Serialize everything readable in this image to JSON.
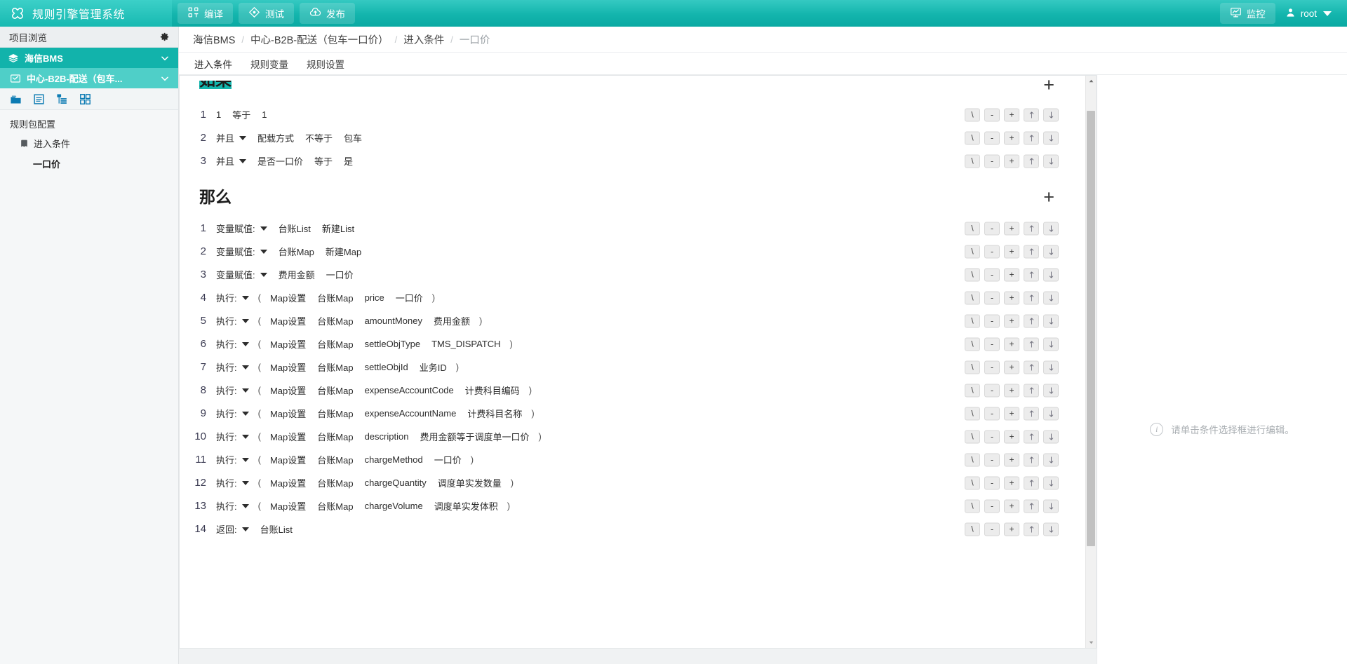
{
  "header": {
    "brand_title": "规则引擎管理系统",
    "logo_icon": "infinity-knot-logo",
    "nav": [
      {
        "label": "编译",
        "icon": "compile-icon"
      },
      {
        "label": "测试",
        "icon": "diamond-test-icon"
      },
      {
        "label": "发布",
        "icon": "cloud-upload-icon"
      }
    ],
    "monitor": {
      "label": "监控",
      "icon": "monitor-chart-icon"
    },
    "user": {
      "name": "root",
      "icon": "user-avatar-icon",
      "caret": "chevron-down-icon"
    }
  },
  "sidebar": {
    "title": "项目浏览",
    "gear_icon": "gear-icon",
    "tree": [
      {
        "label": "海信BMS",
        "icon": "layers-icon",
        "chevron": "chevron-down-icon",
        "level": 1
      },
      {
        "label": "中心-B2B-配送（包车...",
        "icon": "envelope-check-icon",
        "chevron": "chevron-down-icon",
        "level": 2
      }
    ],
    "toolbar_icons": [
      "folder-icon",
      "document-list-icon",
      "tree-outline-icon",
      "grid-icon"
    ],
    "section_label": "规则包配置",
    "items": [
      {
        "label": "进入条件",
        "icon": "book-icon"
      }
    ],
    "leaf": {
      "label": "一口价"
    }
  },
  "breadcrumb": {
    "items": [
      "海信BMS",
      "中心-B2B-配送（包车一口价）",
      "进入条件",
      "一口价"
    ],
    "separator": "/"
  },
  "tabs": [
    {
      "label": "进入条件",
      "active": true
    },
    {
      "label": "规则变量",
      "active": false
    },
    {
      "label": "规则设置",
      "active": false
    }
  ],
  "editor": {
    "if_section": {
      "title": "如果",
      "add_label": "+",
      "rows": [
        {
          "num": "1",
          "fields": [
            {
              "text": "1",
              "type": "value"
            },
            {
              "text": "等于",
              "type": "op"
            },
            {
              "text": "1",
              "type": "value"
            }
          ]
        },
        {
          "num": "2",
          "fields": [
            {
              "text": "并且",
              "type": "dropdown"
            },
            {
              "text": "配载方式",
              "type": "value"
            },
            {
              "text": "不等于",
              "type": "op"
            },
            {
              "text": "包车",
              "type": "value"
            }
          ]
        },
        {
          "num": "3",
          "fields": [
            {
              "text": "并且",
              "type": "dropdown"
            },
            {
              "text": "是否一口价",
              "type": "value"
            },
            {
              "text": "等于",
              "type": "op"
            },
            {
              "text": "是",
              "type": "value"
            }
          ]
        }
      ]
    },
    "then_section": {
      "title": "那么",
      "add_label": "+",
      "rows": [
        {
          "num": "1",
          "fields": [
            {
              "text": "变量赋值:",
              "type": "dropdown"
            },
            {
              "text": "台账List",
              "type": "value"
            },
            {
              "text": "新建List",
              "type": "value"
            }
          ]
        },
        {
          "num": "2",
          "fields": [
            {
              "text": "变量赋值:",
              "type": "dropdown"
            },
            {
              "text": "台账Map",
              "type": "value"
            },
            {
              "text": "新建Map",
              "type": "value"
            }
          ]
        },
        {
          "num": "3",
          "fields": [
            {
              "text": "变量赋值:",
              "type": "dropdown"
            },
            {
              "text": "费用金额",
              "type": "value"
            },
            {
              "text": "一口价",
              "type": "value"
            }
          ]
        },
        {
          "num": "4",
          "fields": [
            {
              "text": "执行:",
              "type": "dropdown"
            },
            {
              "text": "(",
              "type": "paren"
            },
            {
              "text": "Map设置",
              "type": "value"
            },
            {
              "text": "台账Map",
              "type": "value"
            },
            {
              "text": "price",
              "type": "value"
            },
            {
              "text": "一口价",
              "type": "value"
            },
            {
              "text": ")",
              "type": "paren"
            }
          ]
        },
        {
          "num": "5",
          "fields": [
            {
              "text": "执行:",
              "type": "dropdown"
            },
            {
              "text": "(",
              "type": "paren"
            },
            {
              "text": "Map设置",
              "type": "value"
            },
            {
              "text": "台账Map",
              "type": "value"
            },
            {
              "text": "amountMoney",
              "type": "value"
            },
            {
              "text": "费用金额",
              "type": "value"
            },
            {
              "text": ")",
              "type": "paren"
            }
          ]
        },
        {
          "num": "6",
          "fields": [
            {
              "text": "执行:",
              "type": "dropdown"
            },
            {
              "text": "(",
              "type": "paren"
            },
            {
              "text": "Map设置",
              "type": "value"
            },
            {
              "text": "台账Map",
              "type": "value"
            },
            {
              "text": "settleObjType",
              "type": "value"
            },
            {
              "text": "TMS_DISPATCH",
              "type": "value"
            },
            {
              "text": ")",
              "type": "paren"
            }
          ]
        },
        {
          "num": "7",
          "fields": [
            {
              "text": "执行:",
              "type": "dropdown"
            },
            {
              "text": "(",
              "type": "paren"
            },
            {
              "text": "Map设置",
              "type": "value"
            },
            {
              "text": "台账Map",
              "type": "value"
            },
            {
              "text": "settleObjId",
              "type": "value"
            },
            {
              "text": "业务ID",
              "type": "value"
            },
            {
              "text": ")",
              "type": "paren"
            }
          ]
        },
        {
          "num": "8",
          "fields": [
            {
              "text": "执行:",
              "type": "dropdown"
            },
            {
              "text": "(",
              "type": "paren"
            },
            {
              "text": "Map设置",
              "type": "value"
            },
            {
              "text": "台账Map",
              "type": "value"
            },
            {
              "text": "expenseAccountCode",
              "type": "value"
            },
            {
              "text": "计费科目编码",
              "type": "value"
            },
            {
              "text": ")",
              "type": "paren"
            }
          ]
        },
        {
          "num": "9",
          "fields": [
            {
              "text": "执行:",
              "type": "dropdown"
            },
            {
              "text": "(",
              "type": "paren"
            },
            {
              "text": "Map设置",
              "type": "value"
            },
            {
              "text": "台账Map",
              "type": "value"
            },
            {
              "text": "expenseAccountName",
              "type": "value"
            },
            {
              "text": "计费科目名称",
              "type": "value"
            },
            {
              "text": ")",
              "type": "paren"
            }
          ]
        },
        {
          "num": "10",
          "fields": [
            {
              "text": "执行:",
              "type": "dropdown"
            },
            {
              "text": "(",
              "type": "paren"
            },
            {
              "text": "Map设置",
              "type": "value"
            },
            {
              "text": "台账Map",
              "type": "value"
            },
            {
              "text": "description",
              "type": "value"
            },
            {
              "text": "费用金额等于调度单一口价",
              "type": "value"
            },
            {
              "text": ")",
              "type": "paren"
            }
          ]
        },
        {
          "num": "11",
          "fields": [
            {
              "text": "执行:",
              "type": "dropdown"
            },
            {
              "text": "(",
              "type": "paren"
            },
            {
              "text": "Map设置",
              "type": "value"
            },
            {
              "text": "台账Map",
              "type": "value"
            },
            {
              "text": "chargeMethod",
              "type": "value"
            },
            {
              "text": "一口价",
              "type": "value"
            },
            {
              "text": ")",
              "type": "paren"
            }
          ]
        },
        {
          "num": "12",
          "fields": [
            {
              "text": "执行:",
              "type": "dropdown"
            },
            {
              "text": "(",
              "type": "paren"
            },
            {
              "text": "Map设置",
              "type": "value"
            },
            {
              "text": "台账Map",
              "type": "value"
            },
            {
              "text": "chargeQuantity",
              "type": "value"
            },
            {
              "text": "调度单实发数量",
              "type": "value"
            },
            {
              "text": ")",
              "type": "paren"
            }
          ]
        },
        {
          "num": "13",
          "fields": [
            {
              "text": "执行:",
              "type": "dropdown"
            },
            {
              "text": "(",
              "type": "paren"
            },
            {
              "text": "Map设置",
              "type": "value"
            },
            {
              "text": "台账Map",
              "type": "value"
            },
            {
              "text": "chargeVolume",
              "type": "value"
            },
            {
              "text": "调度单实发体积",
              "type": "value"
            },
            {
              "text": ")",
              "type": "paren"
            }
          ]
        },
        {
          "num": "14",
          "fields": [
            {
              "text": "返回:",
              "type": "dropdown"
            },
            {
              "text": "台账List",
              "type": "value"
            }
          ]
        }
      ]
    },
    "row_actions": [
      {
        "label": "\\",
        "name": "branch-button"
      },
      {
        "label": "-",
        "name": "remove-row-button"
      },
      {
        "label": "+",
        "name": "add-row-button"
      },
      {
        "label": "↑",
        "name": "move-up-button"
      },
      {
        "label": "↓",
        "name": "move-down-button"
      }
    ]
  },
  "right_pane": {
    "hint_text": "请单击条件选择框进行编辑。",
    "hint_icon": "info-circle-icon"
  },
  "colors": {
    "brand_teal": "#13b5ad",
    "brand_teal_light": "#4fcfc8",
    "selection_teal": "#13b5ad",
    "sidebar_bg": "#f5f7f8",
    "icon_blue": "#0c7bb3",
    "hint_gray": "#a9aeb2"
  }
}
